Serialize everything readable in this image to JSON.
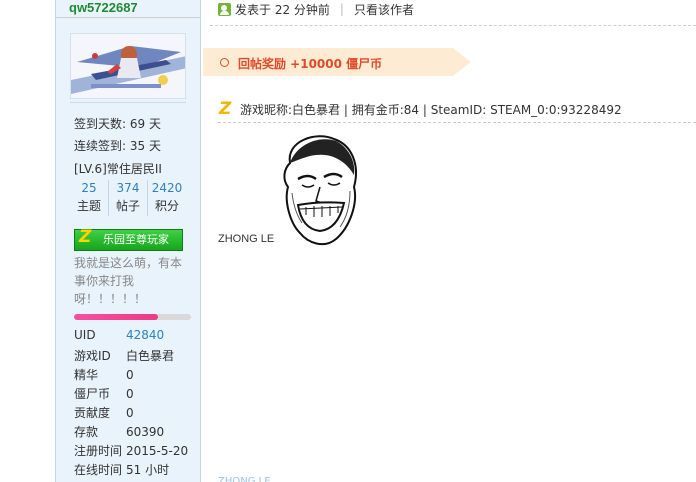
{
  "user": {
    "name": "qw5722687",
    "signin_days": "签到天数: 69 天",
    "consecutive_signin": "连续签到: 35 天",
    "level": "[LV.6]常住居民II",
    "stats": [
      {
        "num": "25",
        "label": "主题"
      },
      {
        "num": "374",
        "label": "帖子"
      },
      {
        "num": "2420",
        "label": "积分"
      }
    ],
    "medal_label": "乐园至尊玩家",
    "signature": "我就是这么萌，有本事你来打我呀！！！！！",
    "progress_fraction": 0.72,
    "details": [
      {
        "k": "UID",
        "v": "42840",
        "link": true
      },
      {
        "k": "游戏ID",
        "v": "白色暴君",
        "link": false
      },
      {
        "k": "精华",
        "v": "0",
        "link": false
      },
      {
        "k": "僵尸币",
        "v": "0",
        "link": false
      },
      {
        "k": "贡献度",
        "v": "0",
        "link": false
      },
      {
        "k": "存款",
        "v": "60390",
        "link": false
      },
      {
        "k": "注册时间",
        "v": "2015-5-20",
        "link": false
      },
      {
        "k": "在线时间",
        "v": "51 小时",
        "link": false
      }
    ]
  },
  "post": {
    "posted": "发表于 22 分钟前",
    "author_only": "只看该作者",
    "reward": "回帖奖励 +10000 僵尸币",
    "game_info": "游戏昵称:白色暴君 | 拥有金币:84 | SteamID: STEAM_0:0:93228492",
    "body": "ZHONG LE"
  },
  "colors": {
    "username": "#1f8a35",
    "link": "#2c81c7",
    "reward": "#e24b2a",
    "sidebar_bg": "#e9f3fb"
  }
}
